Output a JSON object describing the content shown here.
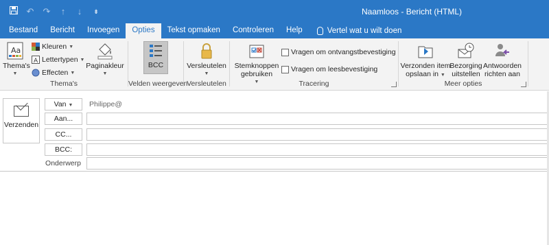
{
  "window": {
    "title": "Naamloos  -  Bericht (HTML)",
    "qat_icons": [
      "save-icon",
      "undo-icon",
      "redo-icon",
      "up-arrow-icon",
      "down-arrow-icon",
      "customize-icon"
    ]
  },
  "tabs": [
    {
      "label": "Bestand",
      "active": false
    },
    {
      "label": "Bericht",
      "active": false
    },
    {
      "label": "Invoegen",
      "active": false
    },
    {
      "label": "Opties",
      "active": true
    },
    {
      "label": "Tekst opmaken",
      "active": false
    },
    {
      "label": "Controleren",
      "active": false
    },
    {
      "label": "Help",
      "active": false
    }
  ],
  "tellme": "Vertel wat u wilt doen",
  "ribbon": {
    "themas": {
      "themes_label": "Thema's",
      "colors_label": "Kleuren",
      "fonts_label": "Lettertypen",
      "effects_label": "Effecten",
      "page_color_label": "Paginakleur",
      "group_label": "Thema's"
    },
    "fields": {
      "bcc_label": "BCC",
      "group_label": "Velden weergeven"
    },
    "encrypt": {
      "label": "Versleutelen",
      "group_label": "Versleutelen"
    },
    "tracking": {
      "voting_line1": "Stemknoppen",
      "voting_line2": "gebruiken",
      "receipt_label": "Vragen om ontvangstbevestiging",
      "read_label": "Vragen om leesbevestiging",
      "group_label": "Tracering"
    },
    "more": {
      "save_sent_line1": "Verzonden item",
      "save_sent_line2": "opslaan in",
      "delay_line1": "Bezorging",
      "delay_line2": "uitstellen",
      "reply_line1": "Antwoorden",
      "reply_line2": "richten aan",
      "group_label": "Meer opties"
    }
  },
  "form": {
    "send_label": "Verzenden",
    "from_label": "Van",
    "from_value": "Philippe@",
    "to_label": "Aan...",
    "cc_label": "CC...",
    "bcc_label": "BCC:",
    "subject_label": "Onderwerp"
  },
  "colors": {
    "accent": "#2b78c6",
    "ribbon_bg": "#f3f3f3"
  }
}
